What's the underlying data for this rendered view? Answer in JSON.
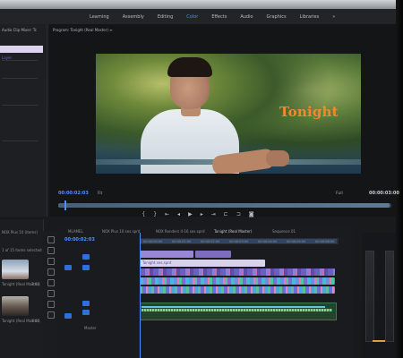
{
  "menu": {
    "items": [
      "Learning",
      "Assembly",
      "Editing",
      "Color",
      "Effects",
      "Audio",
      "Graphics",
      "Libraries",
      "»"
    ],
    "active_index": 3
  },
  "left_panel": {
    "title": "Audio Clip Mixer: Tc",
    "highlighted_item": "Layer"
  },
  "program_monitor": {
    "title": "Program: Tonight (Real Master) ≡",
    "overlay_title": "Tonight",
    "timecode_current": "00:00:02:03",
    "fit_label": "Fit",
    "quality_label": "Full",
    "timecode_duration": "00:00:03:00"
  },
  "transport": {
    "buttons": [
      "mark-in",
      "mark-out",
      "go-to-in",
      "step-back",
      "play",
      "step-forward",
      "go-to-out",
      "insert",
      "overwrite",
      "export-frame"
    ]
  },
  "project_panel": {
    "title": "NOX Plus 10 (items)",
    "selection_text": "1 of 15 items selected",
    "items": [
      "Tonight (Real Master)",
      "Tonight (Real Master)"
    ],
    "counts": [
      "3:03",
      "3:00"
    ]
  },
  "timeline": {
    "tabs": [
      "MLAMEL",
      "NOX Plus 10 ses.sprd",
      "NOX Renders 4-16 ses.sprd",
      "Tonight (Real Master)",
      "Sequence 01"
    ],
    "timecode": "00:00:02:03",
    "ruler_labels": [
      "00:00:00:00",
      "00:00:01:00",
      "00:00:02:00",
      "00:00:03:00",
      "00:00:04:00",
      "00:00:05:00",
      "00:00:06:00"
    ],
    "clip_label": "Tonight ses.sprd",
    "master_label": "Master"
  },
  "colors": {
    "accent_blue": "#4f8cff",
    "title_orange": "#f08a2b",
    "highlight_lilac": "#dcd3ef",
    "audio_green": "#3c7a4c"
  }
}
